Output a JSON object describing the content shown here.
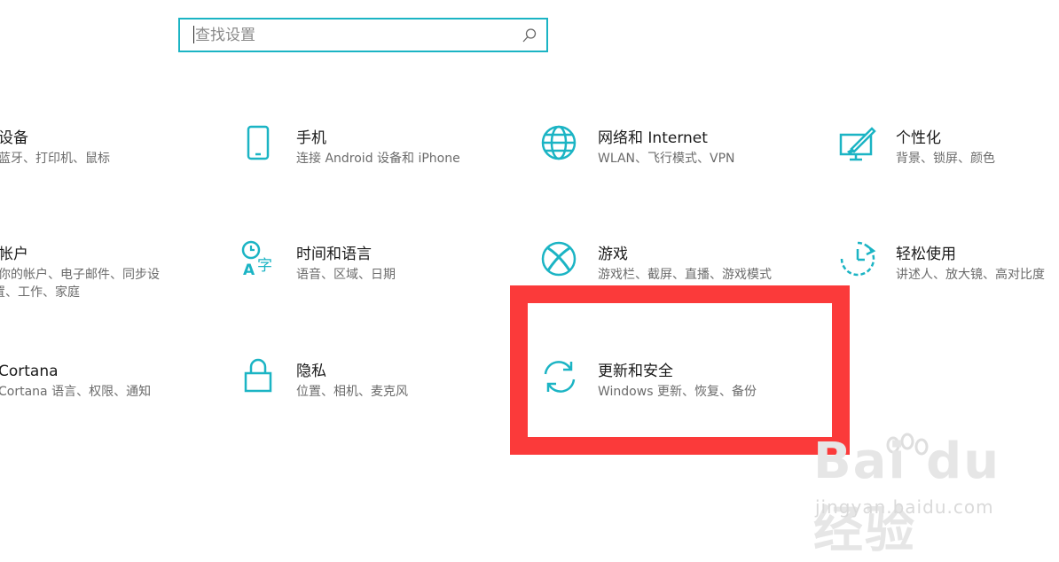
{
  "search": {
    "placeholder": "查找设置"
  },
  "tiles": [
    {
      "title": "设备",
      "desc": "蓝牙、打印机、鼠标",
      "icon": "devices-icon"
    },
    {
      "title": "手机",
      "desc": "连接 Android 设备和 iPhone",
      "icon": "phone-icon"
    },
    {
      "title": "网络和 Internet",
      "desc": "WLAN、飞行模式、VPN",
      "icon": "globe-icon"
    },
    {
      "title": "个性化",
      "desc": "背景、锁屏、颜色",
      "icon": "personalization-icon"
    },
    {
      "title": "帐户",
      "desc1": "你的帐户、电子邮件、同步设",
      "desc2": "置、工作、家庭",
      "icon": "account-icon"
    },
    {
      "title": "时间和语言",
      "desc": "语音、区域、日期",
      "icon": "time-language-icon"
    },
    {
      "title": "游戏",
      "desc": "游戏栏、截屏、直播、游戏模式",
      "icon": "xbox-icon"
    },
    {
      "title": "轻松使用",
      "desc": "讲述人、放大镜、高对比度",
      "icon": "ease-of-access-icon"
    },
    {
      "title": "Cortana",
      "desc": "Cortana 语言、权限、通知",
      "icon": "cortana-icon"
    },
    {
      "title": "隐私",
      "desc": "位置、相机、麦克风",
      "icon": "lock-icon"
    },
    {
      "title": "更新和安全",
      "desc": "Windows 更新、恢复、备份",
      "icon": "sync-icon"
    }
  ],
  "watermark": {
    "brand": "Bai du 经验",
    "url": "jingyan.baidu.com"
  },
  "colors": {
    "accent": "#1bb4c4",
    "highlight": "#fb3a3a"
  }
}
